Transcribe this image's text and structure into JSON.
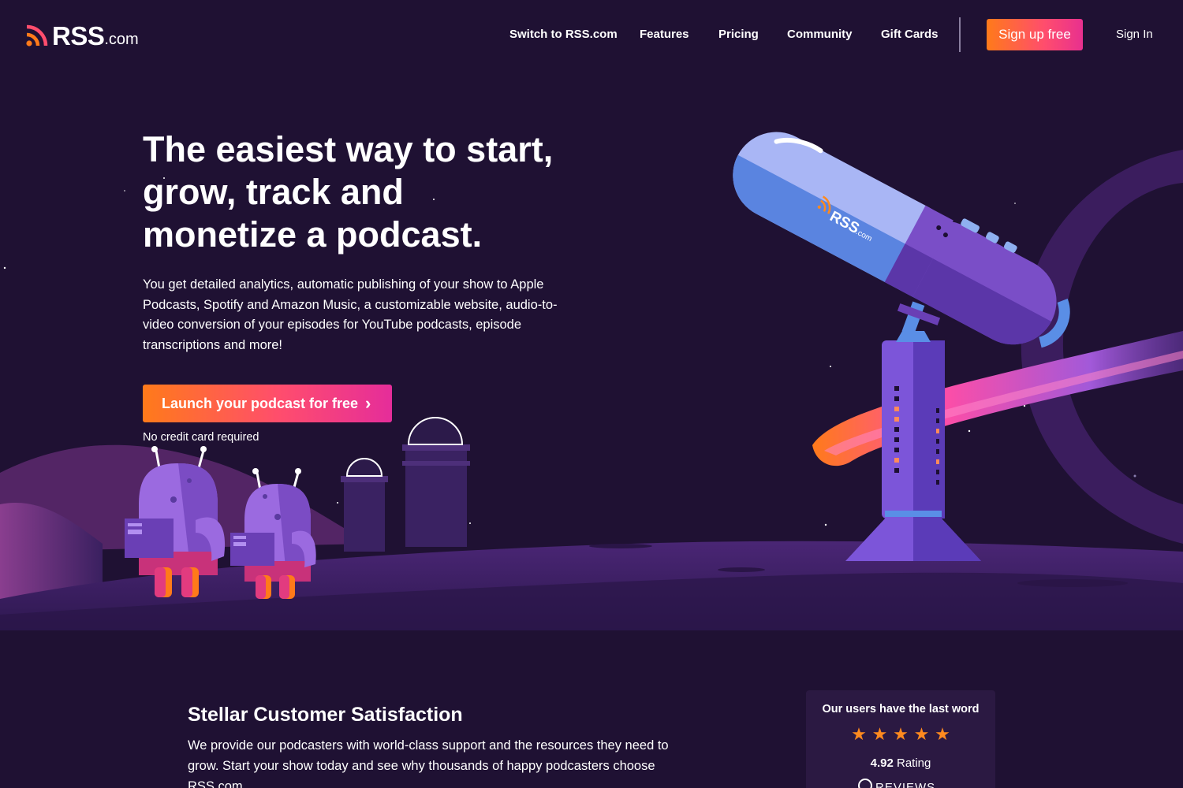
{
  "header": {
    "logo_text": "RSS",
    "logo_suffix": ".com",
    "nav": [
      "Switch to RSS.com",
      "Features",
      "Pricing",
      "Community",
      "Gift Cards"
    ],
    "signup_label": "Sign up free",
    "signin_label": "Sign In"
  },
  "hero": {
    "title_lines": [
      "The easiest way to start,",
      "grow, track and",
      "monetize a podcast."
    ],
    "description": "You get detailed analytics, automatic publishing of your show to Apple Podcasts, Spotify and Amazon Music, a customizable website, audio-to-video conversion of your episodes for YouTube podcasts, episode transcriptions and more!",
    "cta_label": "Launch your podcast for free",
    "cta_chevron": "›",
    "cta_note": "No credit card required",
    "telescope_brand": "RSS",
    "telescope_brand_suffix": ".com"
  },
  "satisfaction": {
    "title": "Stellar Customer Satisfaction",
    "description": "We provide our podcasters with world-class support and the resources they need to grow. Start your show today and see why thousands of happy podcasters choose RSS.com"
  },
  "review_card": {
    "heading": "Our users have the last word",
    "stars": 5,
    "rating_value": "4.92",
    "rating_label": "Rating",
    "reviews_label": "REVIEWS"
  },
  "colors": {
    "background": "#1f1133",
    "accent_orange": "#ff7a1a",
    "accent_pink": "#e52d9a",
    "star": "#ff8a1f"
  }
}
